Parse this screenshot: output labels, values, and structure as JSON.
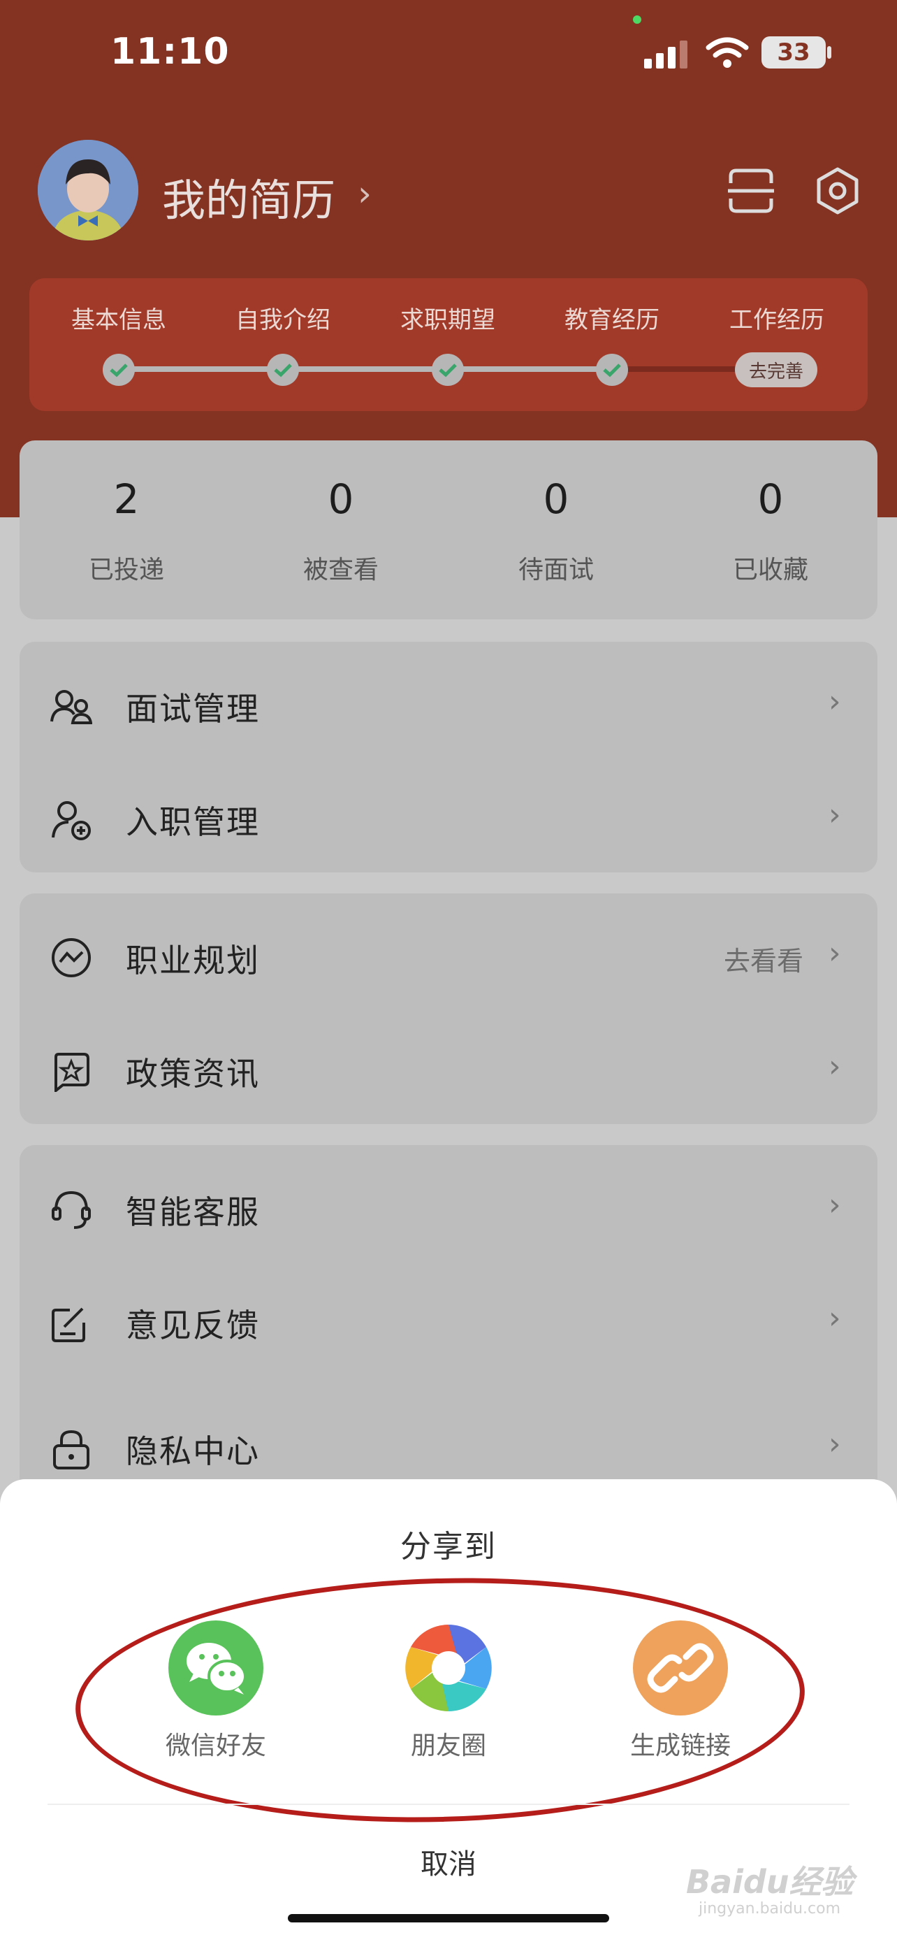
{
  "status_bar": {
    "time": "11:10",
    "battery": "33"
  },
  "profile": {
    "title": "我的简历",
    "chevron": "›"
  },
  "progress": {
    "steps": [
      "基本信息",
      "自我介绍",
      "求职期望",
      "教育经历",
      "工作经历"
    ],
    "completed_count": 4,
    "todo_label": "去完善"
  },
  "stats": [
    {
      "value": "2",
      "label": "已投递"
    },
    {
      "value": "0",
      "label": "被查看"
    },
    {
      "value": "0",
      "label": "待面试"
    },
    {
      "value": "0",
      "label": "已收藏"
    }
  ],
  "menu": {
    "group1": [
      {
        "label": "面试管理",
        "icon": "interview-users-icon"
      },
      {
        "label": "入职管理",
        "icon": "add-user-icon"
      }
    ],
    "group2": [
      {
        "label": "职业规划",
        "extra": "去看看",
        "icon": "trend-icon"
      },
      {
        "label": "政策资讯",
        "icon": "star-document-icon"
      }
    ],
    "group3": [
      {
        "label": "智能客服",
        "icon": "headset-icon"
      },
      {
        "label": "意见反馈",
        "icon": "edit-icon"
      },
      {
        "label": "隐私中心",
        "icon": "lock-icon"
      }
    ],
    "chevron": "›"
  },
  "share_sheet": {
    "title": "分享到",
    "options": [
      {
        "label": "微信好友",
        "color": "#5ac25a",
        "icon": "wechat-icon"
      },
      {
        "label": "朋友圈",
        "color": "#ffffff",
        "icon": "moments-icon"
      },
      {
        "label": "生成链接",
        "color": "#eea25c",
        "icon": "link-icon"
      }
    ],
    "cancel": "取消"
  },
  "watermark": {
    "brand": "Baidu经验",
    "url": "jingyan.baidu.com"
  },
  "colors": {
    "header": "#843222",
    "overlay_bg": "#c9c9c9",
    "annotation": "#b41d1a"
  }
}
